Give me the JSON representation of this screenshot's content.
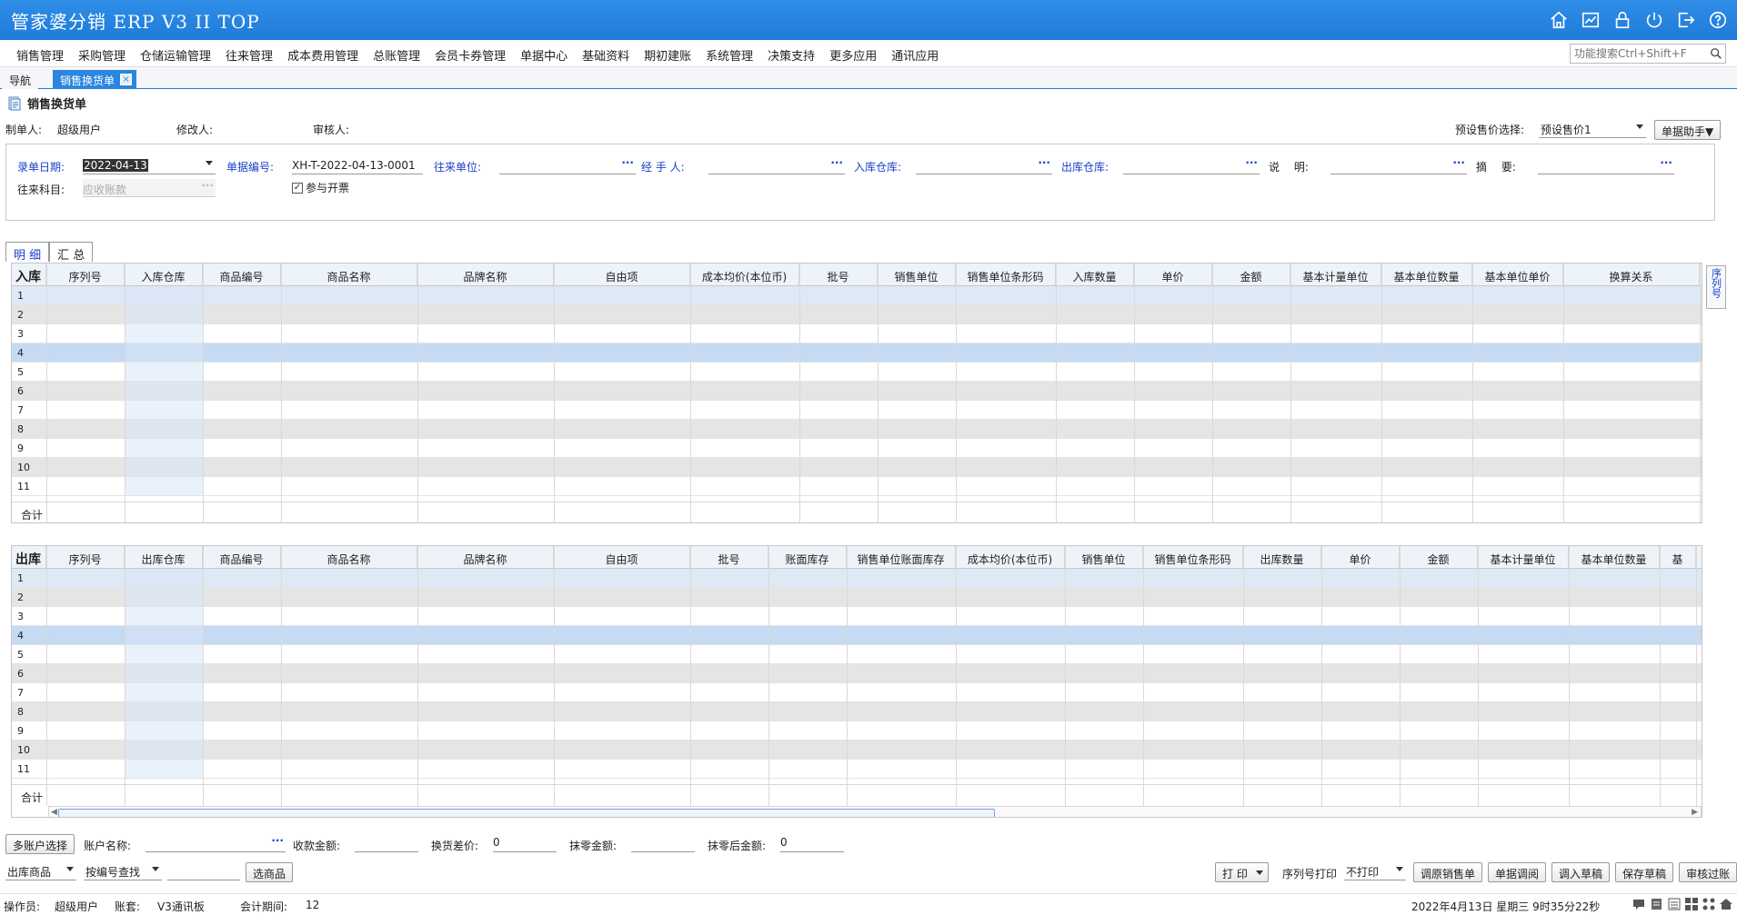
{
  "app": {
    "title": "管家婆分销 ERP V3 II TOP"
  },
  "colors": {
    "header": "#1f7bd8",
    "label_blue": "#1c40c9"
  },
  "top_icons": [
    "home-icon",
    "chart-icon",
    "lock-icon",
    "power-icon",
    "logout-icon",
    "help-icon"
  ],
  "menu": [
    "销售管理",
    "采购管理",
    "仓储运输管理",
    "往来管理",
    "成本费用管理",
    "总账管理",
    "会员卡券管理",
    "单据中心",
    "基础资料",
    "期初建账",
    "系统管理",
    "决策支持",
    "更多应用",
    "通讯应用"
  ],
  "search": {
    "placeholder": "功能搜索Ctrl+Shift+F"
  },
  "tabs": {
    "nav": "导航",
    "doc": "销售换货单"
  },
  "doc": {
    "title": "销售换货单"
  },
  "info": {
    "maker_label": "制单人:",
    "maker": "超级用户",
    "editor_label": "修改人:",
    "reviewer_label": "审核人:",
    "preset_label": "预设售价选择:",
    "preset_value": "预设售价1",
    "helper": "单据助手▼"
  },
  "form": {
    "date_label": "录单日期:",
    "date_value": "2022-04-13",
    "no_label": "单据编号:",
    "no_value": "XH-T-2022-04-13-0001",
    "unit_label": "往来单位:",
    "handler_label": "经 手 人:",
    "in_wh_label": "入库仓库:",
    "out_wh_label": "出库仓库:",
    "note_label": "说　 明:",
    "summary_label": "摘　 要:",
    "subject_label": "往来科目:",
    "subject_value": "应收账款",
    "invoice_label": "参与开票",
    "invoice_checked": true,
    "dots": "···"
  },
  "subtabs": [
    "明 细",
    "汇 总"
  ],
  "in_grid": {
    "lead": "入库",
    "columns": [
      "序列号",
      "入库仓库",
      "商品编号",
      "商品名称",
      "品牌名称",
      "自由项",
      "成本均价(本位币)",
      "批号",
      "销售单位",
      "销售单位条形码",
      "入库数量",
      "单价",
      "金额",
      "基本计量单位",
      "基本单位数量",
      "基本单位单价",
      "换算关系"
    ],
    "rows": [
      "1",
      "2",
      "3",
      "4",
      "5",
      "6",
      "7",
      "8",
      "9",
      "10",
      "11"
    ],
    "sum": "合计"
  },
  "out_grid": {
    "lead": "出库",
    "columns": [
      "序列号",
      "出库仓库",
      "商品编号",
      "商品名称",
      "品牌名称",
      "自由项",
      "批号",
      "账面库存",
      "销售单位账面库存",
      "成本均价(本位币)",
      "销售单位",
      "销售单位条形码",
      "出库数量",
      "单价",
      "金额",
      "基本计量单位",
      "基本单位数量",
      "基"
    ],
    "rows": [
      "1",
      "2",
      "3",
      "4",
      "5",
      "6",
      "7",
      "8",
      "9",
      "10",
      "11"
    ],
    "sum": "合计"
  },
  "side": {
    "serial": "序列号"
  },
  "bottom": {
    "multi_account": "多账户选择",
    "account_label": "账户名称:",
    "receipt_label": "收款金额:",
    "diff_label": "换货差价:",
    "diff_value": "0",
    "round_label": "抹零金额:",
    "after_label": "抹零后金额:",
    "after_value": "0",
    "out_goods": "出库商品",
    "find_by": "按编号查找",
    "select_goods": "选商品",
    "print": "打 印",
    "serial_print_label": "序列号打印",
    "serial_print_value": "不打印",
    "actions": [
      "调原销售单",
      "单据调阅",
      "调入草稿",
      "保存草稿",
      "审核过账"
    ]
  },
  "status": {
    "operator_label": "操作员:",
    "operator": "超级用户",
    "book_label": "账套:",
    "book": "V3通讯板",
    "period_label": "会计期间:",
    "period": "12",
    "datetime": "2022年4月13日 星期三 9时35分22秒"
  }
}
